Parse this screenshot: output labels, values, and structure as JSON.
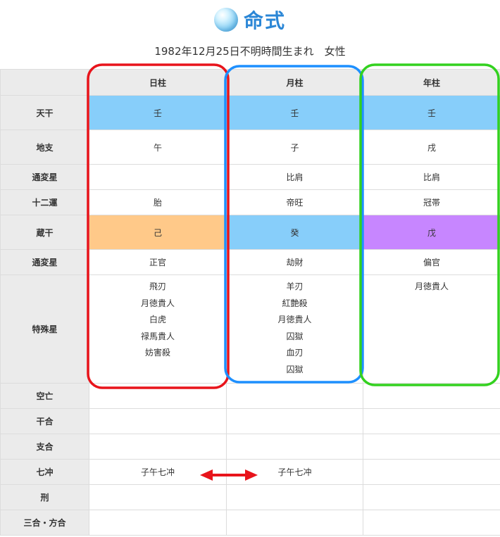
{
  "header": {
    "title": "命式",
    "subtitle": "1982年12月25日不明時間生まれ　女性"
  },
  "columns": [
    "日柱",
    "月柱",
    "年柱"
  ],
  "rows": {
    "tenkan": {
      "label": "天干",
      "values": [
        "壬",
        "壬",
        "壬"
      ]
    },
    "chishi": {
      "label": "地支",
      "values": [
        "午",
        "子",
        "戌"
      ]
    },
    "tsuhen1": {
      "label": "通変星",
      "values": [
        "",
        "比肩",
        "比肩"
      ]
    },
    "juniun": {
      "label": "十二運",
      "values": [
        "胎",
        "帝旺",
        "冠帯"
      ]
    },
    "zoukan": {
      "label": "蔵干",
      "values": [
        "己",
        "癸",
        "戊"
      ]
    },
    "tsuhen2": {
      "label": "通変星",
      "values": [
        "正官",
        "劫財",
        "偏官"
      ]
    },
    "tokushu": {
      "label": "特殊星",
      "values": [
        [
          "飛刃",
          "月徳貴人",
          "白虎",
          "禄馬貴人",
          "妨害殺"
        ],
        [
          "羊刃",
          "紅艶殺",
          "月徳貴人",
          "囚獄",
          "血刃",
          "囚獄"
        ],
        [
          "月徳貴人"
        ]
      ]
    },
    "kubou": {
      "label": "空亡",
      "values": [
        "",
        "",
        ""
      ]
    },
    "kangou": {
      "label": "干合",
      "values": [
        "",
        "",
        ""
      ]
    },
    "shigou": {
      "label": "支合",
      "values": [
        "",
        "",
        ""
      ]
    },
    "shichichu": {
      "label": "七冲",
      "values": [
        "子午七冲",
        "子午七冲",
        ""
      ]
    },
    "kei": {
      "label": "刑",
      "values": [
        "",
        "",
        ""
      ]
    },
    "sangou": {
      "label": "三合・方合",
      "values": [
        "",
        "",
        ""
      ]
    }
  },
  "annotations": {
    "day_pillar_box_color": "#e8141b",
    "month_pillar_box_color": "#1e90ff",
    "year_pillar_box_color": "#33d11f",
    "arrow_color": "#e8141b"
  }
}
